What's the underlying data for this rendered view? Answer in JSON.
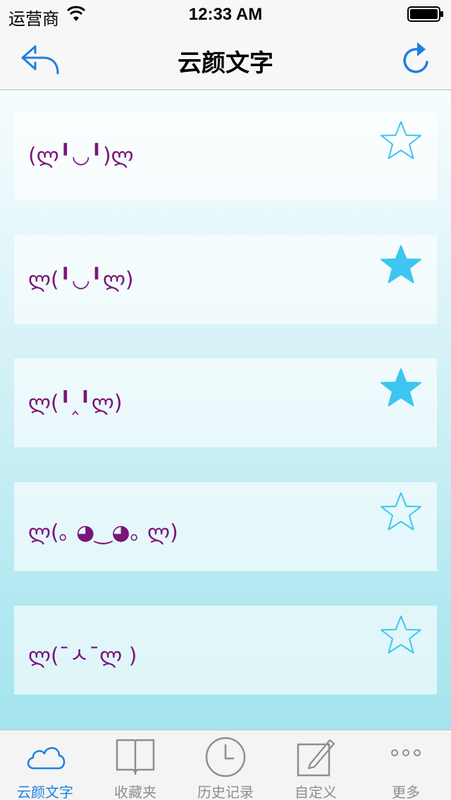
{
  "status_bar": {
    "carrier": "运营商",
    "time": "12:33 AM"
  },
  "nav": {
    "title": "云颜文字"
  },
  "colors": {
    "accent": "#1d7fe3",
    "star": "#3cc6f0",
    "kaomoji": "#7b1479",
    "tab_inactive": "#8e8e8e"
  },
  "items": [
    {
      "text": "(ლ╹◡╹)ლ",
      "favorited": false
    },
    {
      "text": "ლ(╹◡╹ლ)",
      "favorited": true
    },
    {
      "text": "ლ(╹‸╹ლ)",
      "favorited": true
    },
    {
      "text": "ლ(｡ ◕‿◕｡ ლ)",
      "favorited": false
    },
    {
      "text": "ლ(¯ㅅ¯ლ )",
      "favorited": false
    }
  ],
  "tabs": [
    {
      "label": "云颜文字",
      "icon": "cloud-icon",
      "active": true
    },
    {
      "label": "收藏夹",
      "icon": "book-icon",
      "active": false
    },
    {
      "label": "历史记录",
      "icon": "clock-icon",
      "active": false
    },
    {
      "label": "自定义",
      "icon": "edit-icon",
      "active": false
    },
    {
      "label": "更多",
      "icon": "more-icon",
      "active": false
    }
  ]
}
